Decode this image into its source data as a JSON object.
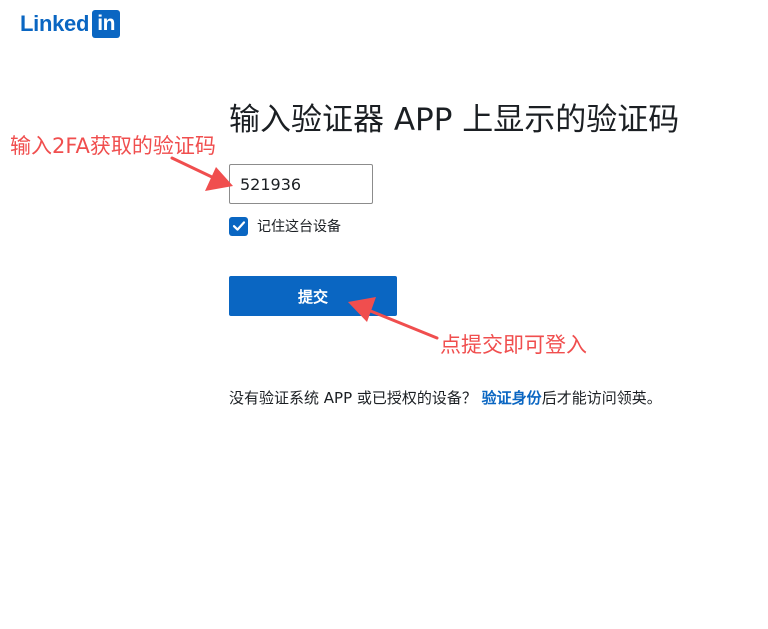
{
  "logo": {
    "text": "Linked",
    "box_text": "in"
  },
  "page": {
    "heading": "输入验证器 APP 上显示的验证码"
  },
  "form": {
    "code_value": "521936",
    "remember_label": "记住这台设备",
    "remember_checked": true,
    "submit_label": "提交"
  },
  "footer": {
    "text_before": "没有验证系统 APP 或已授权的设备？ ",
    "link_label": "验证身份",
    "text_after": "后才能访问领英。"
  },
  "annotations": {
    "input_hint": "输入2FA获取的验证码",
    "submit_hint": "点提交即可登入"
  },
  "colors": {
    "brand": "#0a66c2",
    "annotation": "#f04e4e",
    "text": "#1b1f23"
  }
}
